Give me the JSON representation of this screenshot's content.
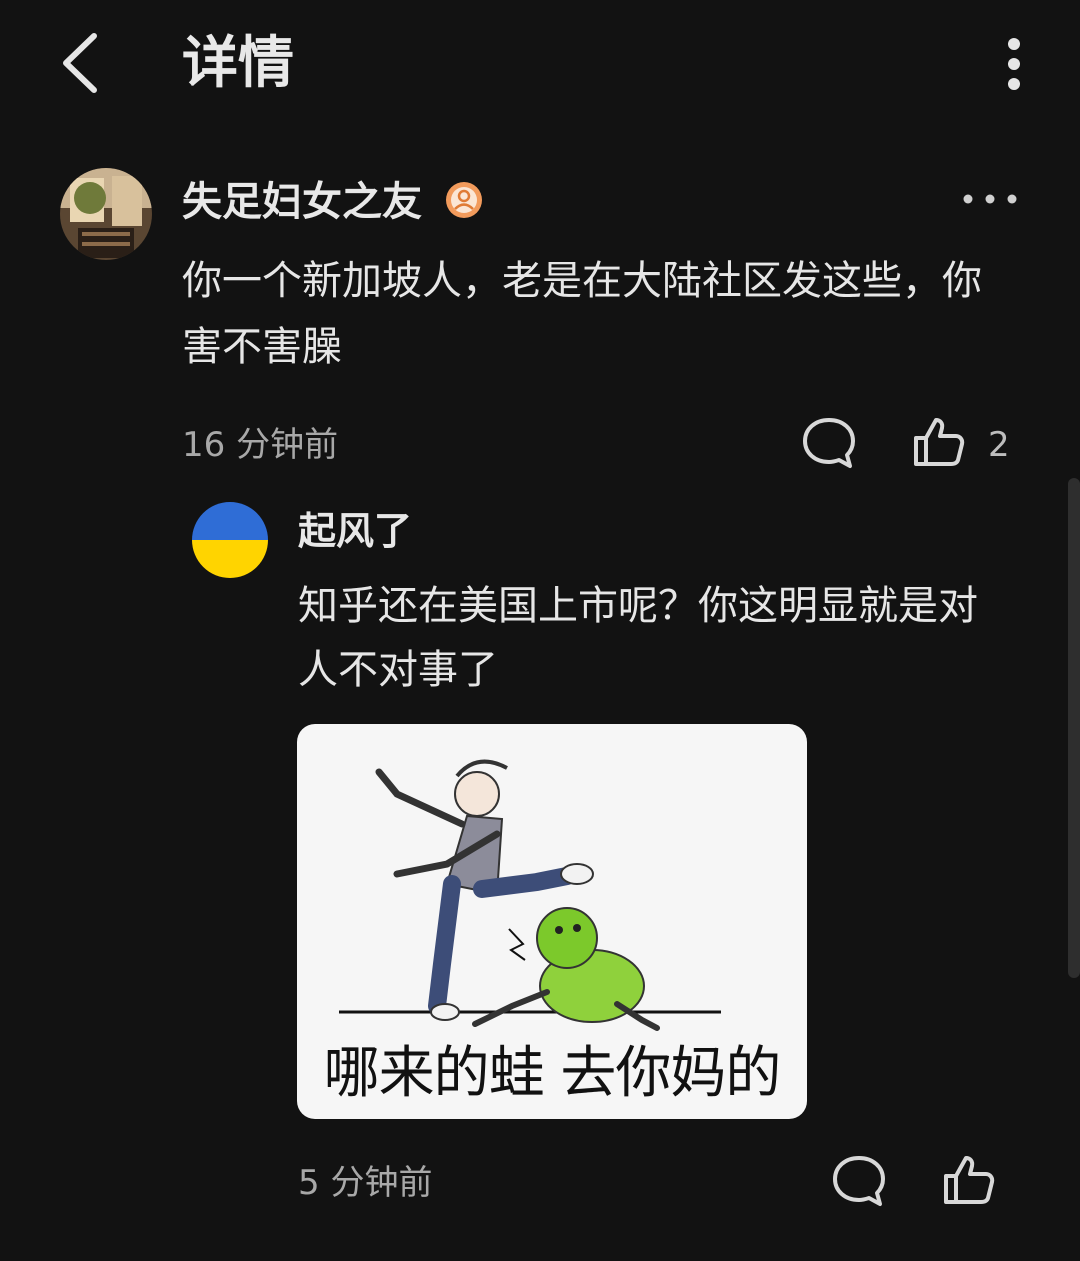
{
  "header": {
    "title": "详情",
    "back_icon": "chevron-left-icon",
    "more_icon": "vertical-dots-icon"
  },
  "comment": {
    "author": "失足妇女之友",
    "badge_icon": "verified-user-badge-icon",
    "text": "你一个新加坡人，老是在大陆社区发这些，你害不害臊",
    "time": "16 分钟前",
    "like_count": "2"
  },
  "reply": {
    "author": "起风了",
    "avatar_colors": {
      "top": "#2f6dd6",
      "bottom": "#ffd400"
    },
    "text": "知乎还在美国上市呢？你这明显就是对人不对事了",
    "image_caption": "哪来的蛙 去你妈的",
    "time": "5 分钟前"
  },
  "colors": {
    "background": "#121212",
    "text": "#e6e6e6",
    "muted": "#a8a8a8",
    "badge": "#f29b5c"
  }
}
